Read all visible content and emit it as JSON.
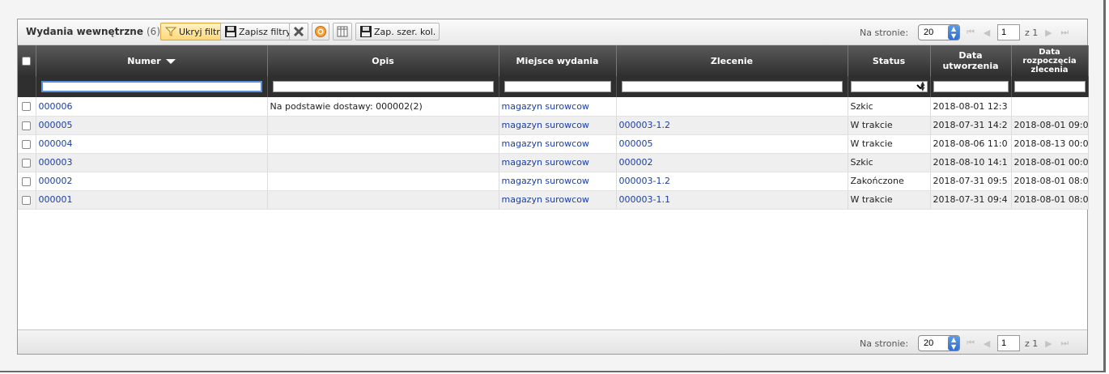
{
  "toolbar": {
    "title": "Wydania wewnętrzne",
    "count": "(6)",
    "hide_filter_label": "Ukryj filtr",
    "save_filters_label": "Zapisz filtry",
    "save_col_widths_label": "Zap. szer. kol."
  },
  "pager": {
    "per_page_label": "Na stronie:",
    "per_page_value": "20",
    "page_value": "1",
    "of_label": "z 1"
  },
  "columns": {
    "numer": "Numer",
    "opis": "Opis",
    "miejsce": "Miejsce wydania",
    "zlecenie": "Zlecenie",
    "status": "Status",
    "data_utworzenia": "Data utworzenia",
    "data_rozpoczecia": "Data rozpoczęcia zlecenia"
  },
  "rows": [
    {
      "numer": "000006",
      "opis": "Na podstawie dostawy: 000002(2)",
      "miejsce": "magazyn surowcow",
      "zlecenie": "",
      "status": "Szkic",
      "data_utworzenia": "2018-08-01 12:3",
      "data_rozpoczecia": ""
    },
    {
      "numer": "000005",
      "opis": "",
      "miejsce": "magazyn surowcow",
      "zlecenie": "000003-1.2",
      "status": "W trakcie",
      "data_utworzenia": "2018-07-31 14:2",
      "data_rozpoczecia": "2018-08-01 09:0"
    },
    {
      "numer": "000004",
      "opis": "",
      "miejsce": "magazyn surowcow",
      "zlecenie": "000005",
      "status": "W trakcie",
      "data_utworzenia": "2018-08-06 11:0",
      "data_rozpoczecia": "2018-08-13 00:0"
    },
    {
      "numer": "000003",
      "opis": "",
      "miejsce": "magazyn surowcow",
      "zlecenie": "000002",
      "status": "Szkic",
      "data_utworzenia": "2018-08-10 14:1",
      "data_rozpoczecia": "2018-08-01 00:0"
    },
    {
      "numer": "000002",
      "opis": "",
      "miejsce": "magazyn surowcow",
      "zlecenie": "000003-1.2",
      "status": "Zakończone",
      "data_utworzenia": "2018-07-31 09:5",
      "data_rozpoczecia": "2018-08-01 08:0"
    },
    {
      "numer": "000001",
      "opis": "",
      "miejsce": "magazyn surowcow",
      "zlecenie": "000003-1.1",
      "status": "W trakcie",
      "data_utworzenia": "2018-07-31 09:4",
      "data_rozpoczecia": "2018-08-01 08:0"
    }
  ],
  "icons": {
    "filter": "funnel-icon",
    "save": "floppy-disk-icon",
    "clear": "x-icon",
    "reset": "circle-arrow-icon",
    "columns": "columns-icon",
    "first": "first-page-icon",
    "prev": "prev-page-icon",
    "next": "next-page-icon",
    "last": "last-page-icon"
  },
  "colors": {
    "link": "#1c3fa0",
    "header_bg": "#2f2f2f",
    "active_button": "#ffd97a"
  }
}
